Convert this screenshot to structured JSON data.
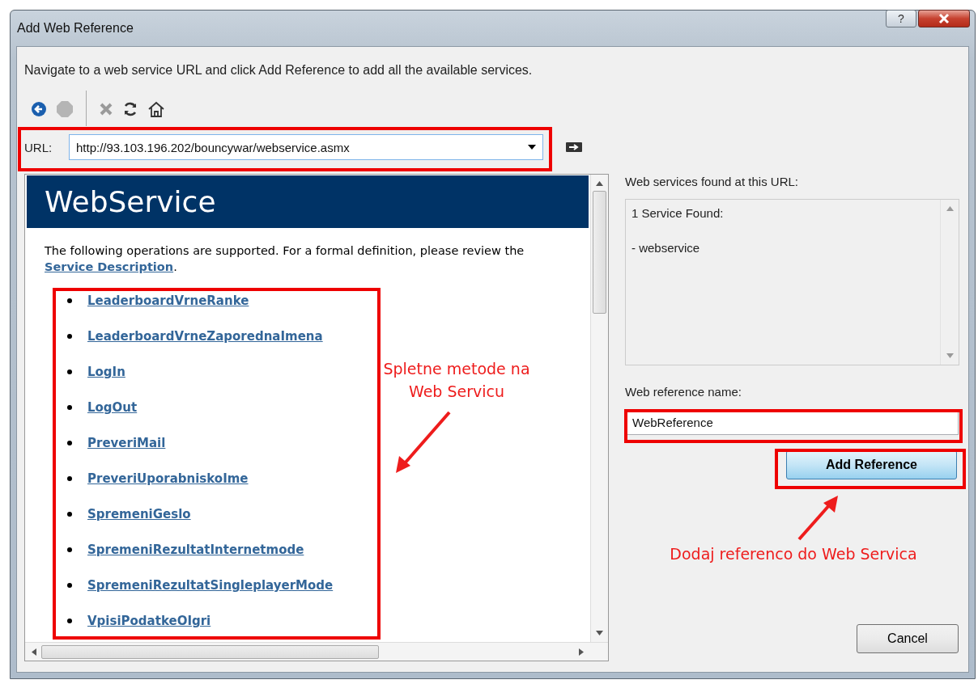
{
  "window": {
    "title": "Add Web Reference",
    "help": "?"
  },
  "instruction": "Navigate to a web service URL and click Add Reference to add all the available services.",
  "url": {
    "label": "URL:",
    "value": "http://93.103.196.202/bouncywar/webservice.asmx"
  },
  "browser": {
    "heading": "WebService",
    "paragraph": {
      "text": "The following operations are supported. For a formal definition, please review the",
      "link": "Service Description",
      "end": "."
    },
    "operations": [
      "LeaderboardVrneRanke",
      "LeaderboardVrneZaporednaImena",
      "LogIn",
      "LogOut",
      "PreveriMail",
      "PreveriUporabniskoIme",
      "SpremeniGeslo",
      "SpremeniRezultatInternetmode",
      "SpremeniRezultatSingleplayerMode",
      "VpisiPodatkeOIgri"
    ]
  },
  "services": {
    "label": "Web services found at this URL:",
    "lines": [
      "1 Service Found:",
      "- webservice"
    ]
  },
  "reference_name": {
    "label": "Web reference name:",
    "value": "WebReference"
  },
  "buttons": [
    {
      "label": "Add Reference",
      "kind": "primary"
    },
    {
      "label": "Cancel",
      "kind": "normal"
    }
  ],
  "annotations": [
    {
      "text": "Spletne metode na Web Servicu"
    },
    {
      "text": "Dodaj referenco do Web Servica"
    }
  ]
}
